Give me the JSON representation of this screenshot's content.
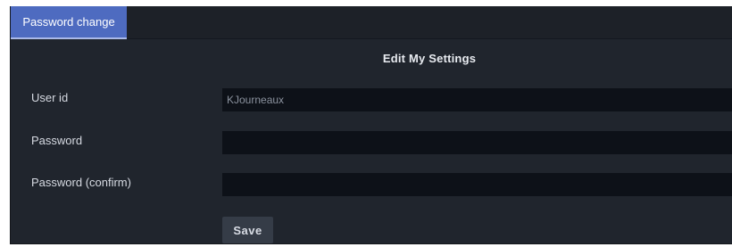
{
  "tabs": [
    {
      "label": "Password change",
      "active": true
    }
  ],
  "form": {
    "title": "Edit My Settings",
    "user_id": {
      "label": "User id",
      "value": "KJourneaux"
    },
    "password": {
      "label": "Password",
      "value": ""
    },
    "password_confirm": {
      "label": "Password (confirm)",
      "value": ""
    },
    "save_label": "Save"
  },
  "colors": {
    "panel_bg": "#20252d",
    "tab_active": "#4e6bc0",
    "field_bg": "#0d1118",
    "button_bg": "#353c47"
  }
}
